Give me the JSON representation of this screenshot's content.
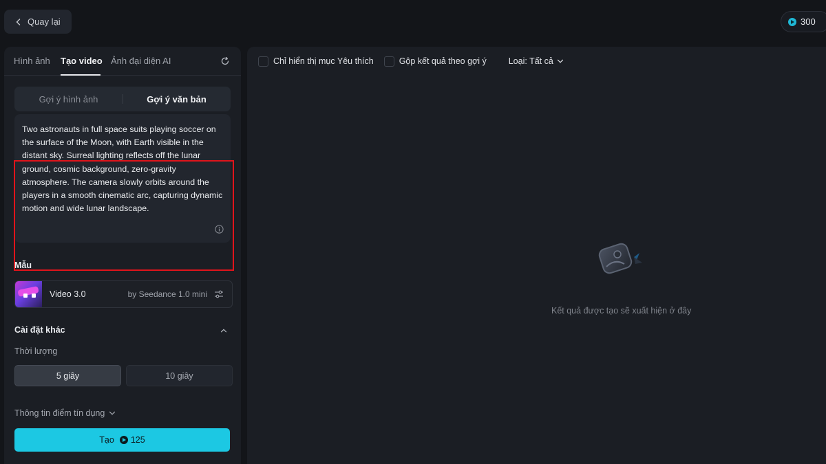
{
  "header": {
    "back_label": "Quay lại",
    "credits": "300"
  },
  "left": {
    "tabs": [
      {
        "label": "Hình ảnh",
        "active": false
      },
      {
        "label": "Tạo video",
        "active": true
      },
      {
        "label": "Ảnh đại diện AI",
        "active": false
      }
    ],
    "segments": [
      {
        "label": "Gợi ý hình ảnh",
        "active": false
      },
      {
        "label": "Gợi ý văn bản",
        "active": true
      }
    ],
    "prompt": "Two astronauts in full space suits playing soccer on the surface of the Moon, with Earth visible in the distant sky. Surreal lighting reflects off the lunar ground, cosmic background, zero-gravity atmosphere. The camera slowly orbits around the players in a smooth cinematic arc, capturing dynamic motion and wide lunar landscape.",
    "model_section": "Mẫu",
    "model": {
      "name": "Video 3.0",
      "by": "by Seedance 1.0 mini"
    },
    "other_settings": "Cài đặt khác",
    "duration_label": "Thời lượng",
    "durations": [
      {
        "label": "5 giây",
        "selected": true
      },
      {
        "label": "10 giây",
        "selected": false
      }
    ],
    "credit_info": "Thông tin điểm tín dụng",
    "create": {
      "label": "Tạo",
      "cost": "125"
    }
  },
  "right": {
    "favorites_only": "Chỉ hiển thị mục Yêu thích",
    "group_by_prompt": "Gộp kết quả theo gợi ý",
    "type_filter": "Loại: Tất cả",
    "empty_message": "Kết quả được tạo sẽ xuất hiện ở đây"
  },
  "colors": {
    "accent": "#1cc8e3",
    "highlight_border": "#e0141b",
    "background": "#131519",
    "panel": "#1b1e24"
  },
  "icons": [
    "chevron-left-icon",
    "coin-icon",
    "refresh-icon",
    "info-icon",
    "sliders-icon",
    "chevron-up-icon",
    "chevron-down-icon",
    "empty-results-icon"
  ]
}
